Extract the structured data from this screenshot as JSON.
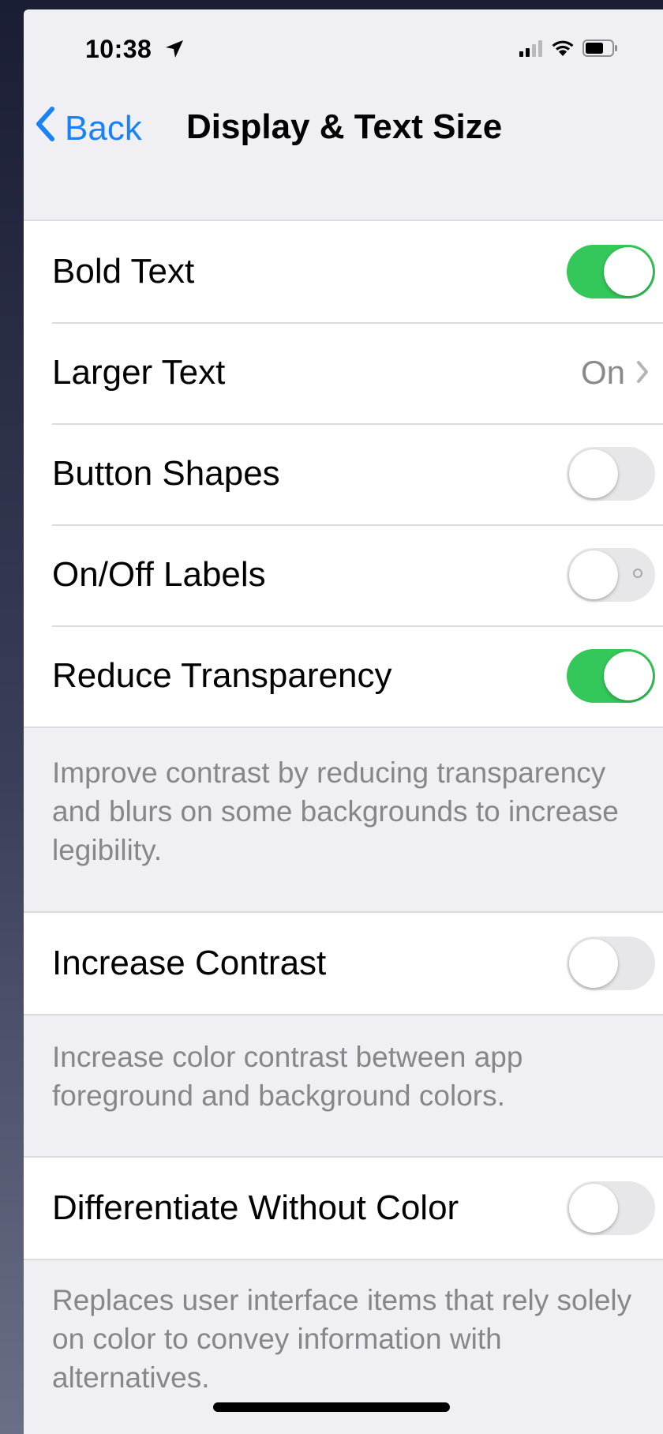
{
  "status_bar": {
    "time": "10:38"
  },
  "nav": {
    "back_label": "Back",
    "title": "Display & Text Size"
  },
  "group1": {
    "bold_text": {
      "label": "Bold Text",
      "on": true
    },
    "larger_text": {
      "label": "Larger Text",
      "value": "On"
    },
    "button_shapes": {
      "label": "Button Shapes",
      "on": false
    },
    "onoff_labels": {
      "label": "On/Off Labels",
      "on": false
    },
    "reduce_transparency": {
      "label": "Reduce Transparency",
      "on": true
    },
    "footer": "Improve contrast by reducing transparency and blurs on some backgrounds to increase legibility."
  },
  "group2": {
    "increase_contrast": {
      "label": "Increase Contrast",
      "on": false
    },
    "footer": "Increase color contrast between app foreground and background colors."
  },
  "group3": {
    "differentiate": {
      "label": "Differentiate Without Color",
      "on": false
    },
    "footer": "Replaces user interface items that rely solely on color to convey information with alternatives."
  },
  "colors": {
    "accent_blue": "#1a82f7",
    "toggle_on_green": "#34c759",
    "toggle_off_gray": "#e7e7ea",
    "background": "#efeff4"
  },
  "icons": [
    "location-arrow-icon",
    "cellular-signal-icon",
    "wifi-icon",
    "battery-icon",
    "chevron-left-icon",
    "chevron-right-icon"
  ]
}
